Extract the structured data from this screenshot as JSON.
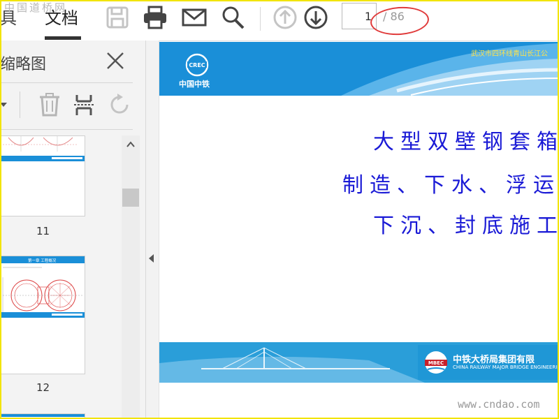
{
  "watermark": {
    "top": "中国道桥网",
    "bottom": "www.cndao.com"
  },
  "toolbar": {
    "tab_tools": "具",
    "tab_document": "文档",
    "page_current": "1",
    "page_total": "/ 86",
    "icons": [
      "save-icon",
      "print-icon",
      "mail-icon",
      "search-icon",
      "previous-page-icon",
      "next-page-icon"
    ]
  },
  "panel": {
    "title": "缩略图",
    "thumbnails": [
      {
        "label": "11",
        "footer_text": "中铁大桥局集团有限公司"
      },
      {
        "label": "12",
        "header_text": "第一章  工程概况",
        "footer_text": "中铁大桥局集团有限公司"
      }
    ]
  },
  "document": {
    "header_logo_text": "中国中铁",
    "header_logo_mark": "CREC",
    "header_project": "武汉市四环线青山长江公",
    "title_lines": [
      "大型双壁钢套箱围",
      "制造、下水、浮运、定",
      "下沉、封底施工技"
    ],
    "footer_logo_mark": "MBEC",
    "footer_company": "中铁大桥局集团有限",
    "footer_company_en": "CHINA RAILWAY MAJOR BRIDGE ENGINEERING GRO"
  },
  "colors": {
    "header_blue": "#1a8fd8",
    "title_blue": "#1a1ad6",
    "annotation_red": "#e03a3a",
    "frame_yellow": "#f2e400"
  }
}
